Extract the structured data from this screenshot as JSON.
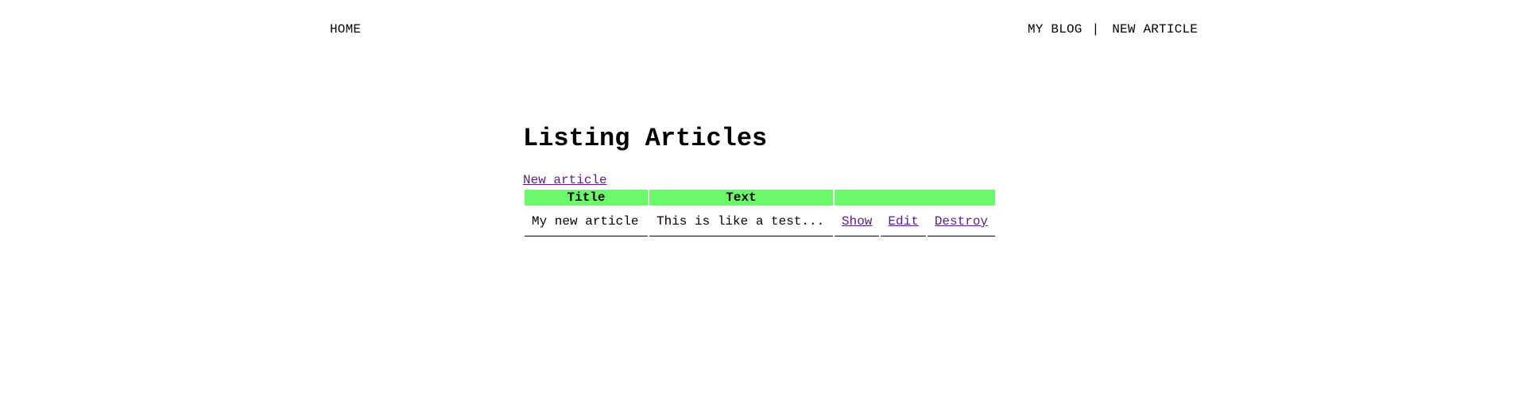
{
  "nav": {
    "home_label": "HOME",
    "blog_label": "MY BLOG",
    "separator": "|",
    "new_article_label": "NEW ARTICLE"
  },
  "main": {
    "title": "Listing Articles",
    "new_article_link": "New article",
    "table": {
      "headers": [
        "Title",
        "Text",
        ""
      ],
      "rows": [
        {
          "title": "My new article",
          "text": "This is like a test...",
          "show_label": "Show",
          "edit_label": "Edit",
          "destroy_label": "Destroy"
        }
      ]
    },
    "colors": {
      "header_bg": "#6cfa6c",
      "link": "#5b1a8b"
    }
  }
}
